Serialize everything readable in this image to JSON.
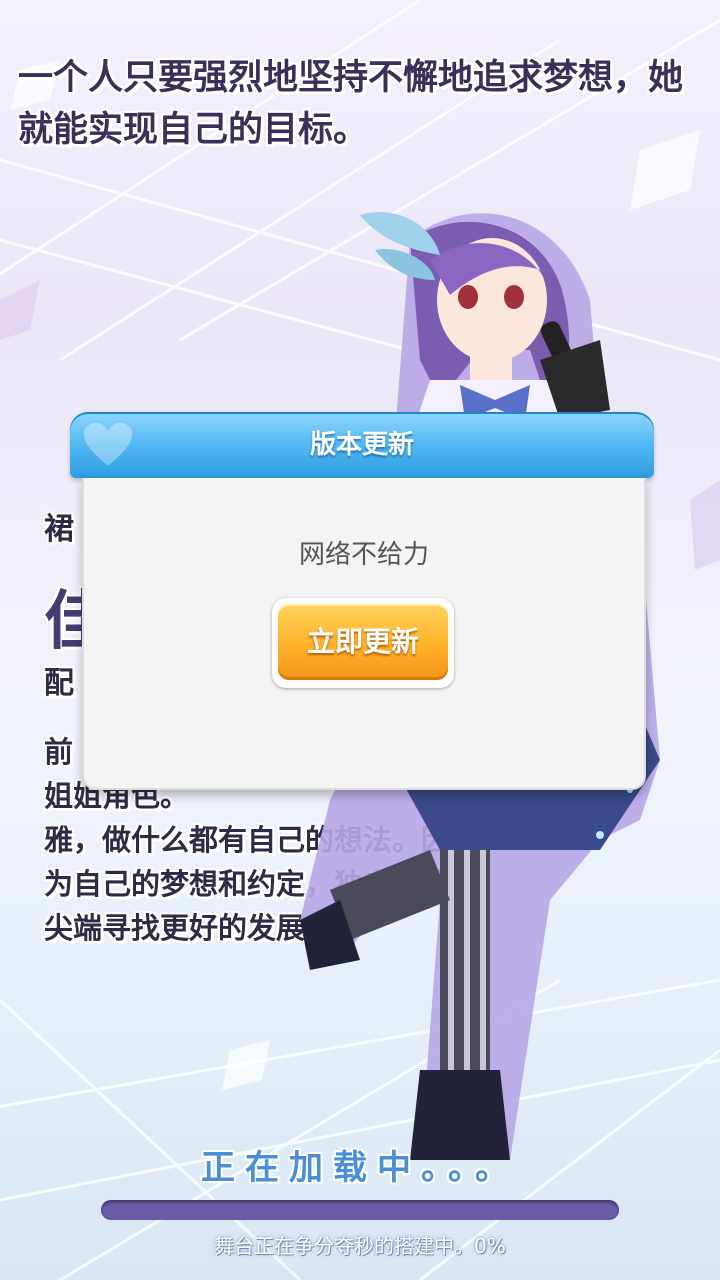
{
  "quote": {
    "line1": "一个人只要强烈地坚持不懈地追求梦想，她",
    "line2": "就能实现自己的目标。"
  },
  "profile": {
    "line_a": "裙",
    "name": "佳",
    "line_c": "配",
    "desc_line1": "前",
    "desc_line2": "姐姐角色。",
    "desc_line3": "雅，做什么都有自己的想法。因",
    "desc_line4": "为自己的梦想和约定，独自前往",
    "desc_line5": "尖端寻找更好的发展。"
  },
  "dialog": {
    "title": "版本更新",
    "message": "网络不给力",
    "button_label": "立即更新"
  },
  "loading": {
    "label": "正在加载中。。。",
    "status": "舞台正在争分夺秒的搭建中。0%",
    "progress": 0
  },
  "colors": {
    "dialog_header": "#52b8f2",
    "button": "#ffb02a",
    "progress_track": "#6a5aa8",
    "loading_text": "#4a8fd6"
  }
}
